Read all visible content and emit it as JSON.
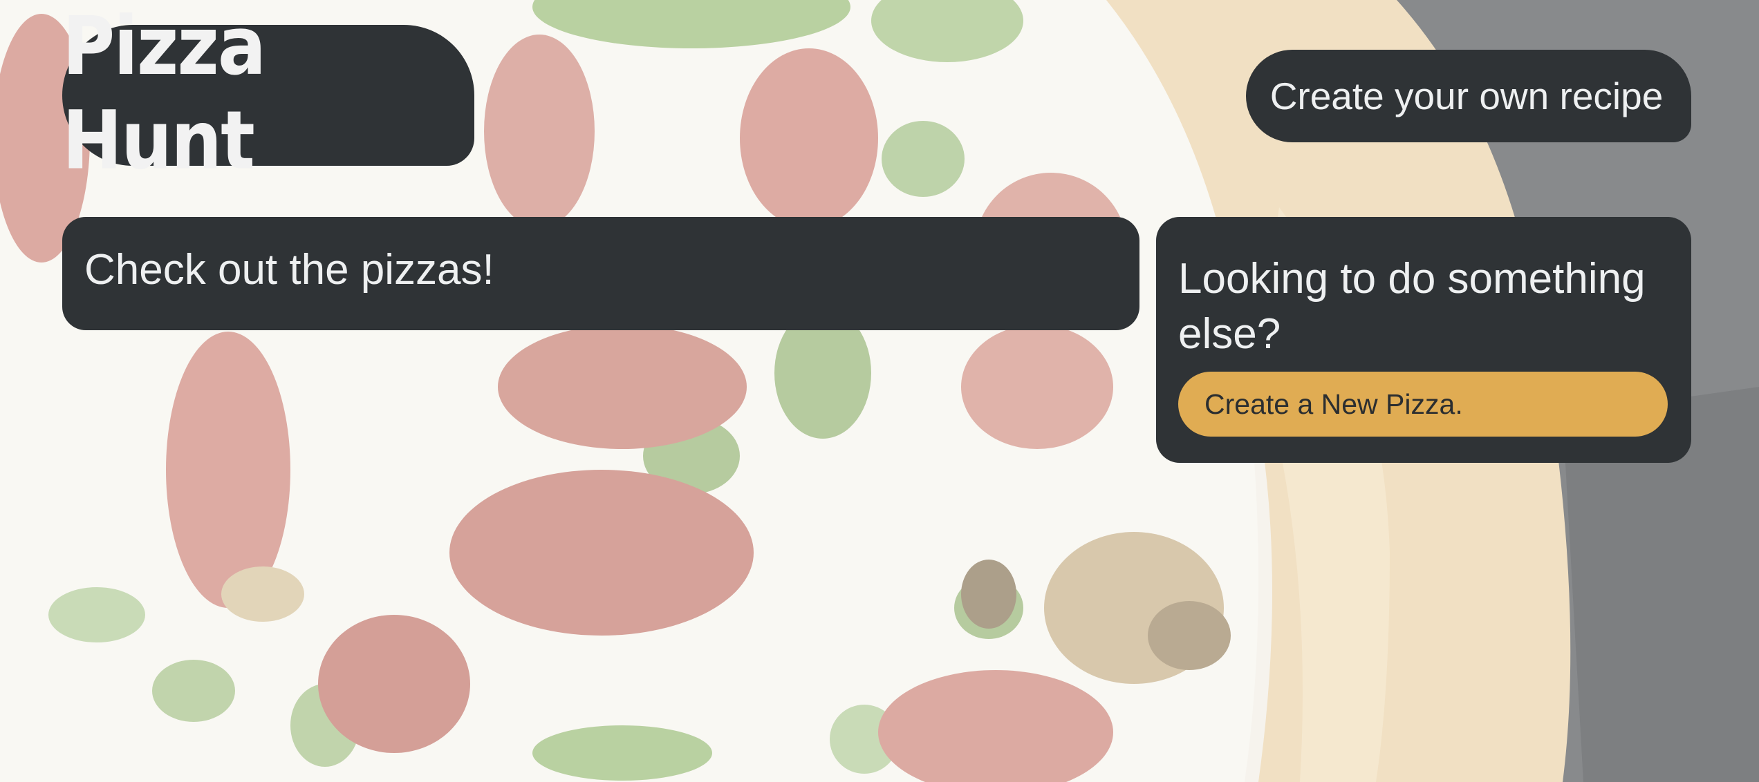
{
  "header": {
    "logo_text": "Pizza Hunt",
    "create_recipe_label": "Create your own recipe"
  },
  "main": {
    "pizzas_heading": "Check out the pizzas!",
    "else_heading": "Looking to do something else?",
    "new_pizza_label": "Create a New Pizza."
  },
  "theme": {
    "panel_color": "#2f3336",
    "accent_color": "#e0ac53",
    "text_color": "#eef0f1"
  },
  "background": {
    "image": "pizza-photo"
  }
}
